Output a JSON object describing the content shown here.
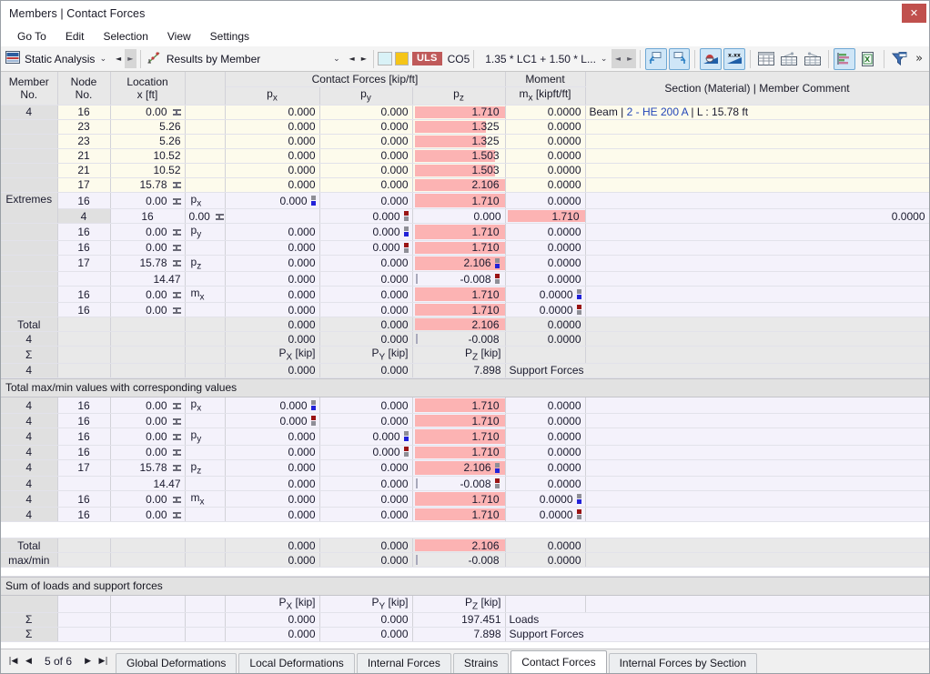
{
  "window": {
    "title": "Members | Contact Forces",
    "close_label": "✕"
  },
  "menu": {
    "items": [
      "Go To",
      "Edit",
      "Selection",
      "View",
      "Settings"
    ]
  },
  "toolbar": {
    "analysis_combo": {
      "label": "Static Analysis",
      "icon": "analysis-icon",
      "chevron": "⌄",
      "prev": "◄",
      "next": "►"
    },
    "results_combo": {
      "label": "Results by Member",
      "icon": "results-chart-icon",
      "chevron": "⌄",
      "prev": "◄",
      "next": "►"
    },
    "swatch_1_color": "#d9f2f7",
    "swatch_2_color": "#f5c518",
    "uls_badge": "ULS",
    "uls_color": "#bf5a5a",
    "combination_id": "CO5",
    "combination_text": "1.35 * LC1 + 1.50 * L...",
    "combination_chevron": "⌄",
    "combo_prev": "◄",
    "combo_next": "►",
    "icons": [
      {
        "name": "undo-arrow-icon",
        "active": true
      },
      {
        "name": "redo-arrow-icon",
        "active": true
      },
      {
        "name": "result-diagram-icon",
        "active": true
      },
      {
        "name": "result-values-icon",
        "active": true
      },
      {
        "name": "table-full-icon",
        "active": false
      },
      {
        "name": "table-filter-left-icon",
        "active": false
      },
      {
        "name": "table-filter-right-icon",
        "active": false
      },
      {
        "name": "bar-chart-icon",
        "active": true
      },
      {
        "name": "export-excel-icon",
        "active": false
      },
      {
        "name": "filter-funnel-icon",
        "active": false
      }
    ],
    "overflow_label": "»"
  },
  "table": {
    "headers": {
      "member_no": "Member\nNo.",
      "member_no_l1": "Member",
      "member_no_l2": "No.",
      "node_no_l1": "Node",
      "node_no_l2": "No.",
      "location_l1": "Location",
      "location_l2": "x [ft]",
      "contact_forces_group": "Contact Forces [kip/ft]",
      "px": "p",
      "px_sub": "x",
      "py": "p",
      "py_sub": "y",
      "pz": "p",
      "pz_sub": "z",
      "moment_group": "Moment",
      "mx": "m",
      "mx_sub": "x",
      "mx_unit": " [kipft/ft]",
      "section": "Section (Material) | Member Comment"
    },
    "member_rows": [
      {
        "member": "4",
        "node": "16",
        "loc": "0.00",
        "support": true,
        "sym": "",
        "px": "0.000",
        "py": "0.000",
        "pz": "1.710",
        "pzbar": 100,
        "mx": "0.0000",
        "sec_prefix": "Beam | ",
        "sec_link": "2 - HE 200 A",
        "sec_suffix": " | L : 15.78 ft",
        "style": "rowA"
      },
      {
        "member": "",
        "node": "23",
        "loc": "5.26",
        "support": false,
        "sym": "",
        "px": "0.000",
        "py": "0.000",
        "pz": "1.325",
        "pzbar": 78,
        "mx": "0.0000",
        "sec_prefix": "",
        "sec_link": "",
        "sec_suffix": "",
        "style": "rowA"
      },
      {
        "member": "",
        "node": "23",
        "loc": "5.26",
        "support": false,
        "sym": "",
        "px": "0.000",
        "py": "0.000",
        "pz": "1.325",
        "pzbar": 78,
        "mx": "0.0000",
        "sec_prefix": "",
        "sec_link": "",
        "sec_suffix": "",
        "style": "rowA"
      },
      {
        "member": "",
        "node": "21",
        "loc": "10.52",
        "support": false,
        "sym": "",
        "px": "0.000",
        "py": "0.000",
        "pz": "1.503",
        "pzbar": 88,
        "mx": "0.0000",
        "sec_prefix": "",
        "sec_link": "",
        "sec_suffix": "",
        "style": "rowA"
      },
      {
        "member": "",
        "node": "21",
        "loc": "10.52",
        "support": false,
        "sym": "",
        "px": "0.000",
        "py": "0.000",
        "pz": "1.503",
        "pzbar": 88,
        "mx": "0.0000",
        "sec_prefix": "",
        "sec_link": "",
        "sec_suffix": "",
        "style": "rowA"
      },
      {
        "member": "",
        "node": "17",
        "loc": "15.78",
        "support": true,
        "sym": "",
        "px": "0.000",
        "py": "0.000",
        "pz": "2.106",
        "pzbar": 100,
        "mx": "0.0000",
        "sec_prefix": "",
        "sec_link": "",
        "sec_suffix": "",
        "style": "rowA"
      }
    ],
    "extremes_label_l1": "Extremes",
    "extremes_label_l2": "4",
    "extreme_rows": [
      {
        "node": "16",
        "loc": "0.00",
        "support": true,
        "sym": "p",
        "sym_sub": "x",
        "px": "0.000",
        "px_mark": "max",
        "py": "0.000",
        "py_mark": "",
        "pz": "1.710",
        "pzbar": 100,
        "pz_mark": "",
        "mx": "0.0000",
        "mx_mark": ""
      },
      {
        "node": "16",
        "loc": "0.00",
        "support": true,
        "sym": "",
        "sym_sub": "",
        "px": "0.000",
        "px_mark": "min",
        "py": "0.000",
        "py_mark": "",
        "pz": "1.710",
        "pzbar": 100,
        "pz_mark": "",
        "mx": "0.0000",
        "mx_mark": ""
      },
      {
        "node": "16",
        "loc": "0.00",
        "support": true,
        "sym": "p",
        "sym_sub": "y",
        "px": "0.000",
        "px_mark": "",
        "py": "0.000",
        "py_mark": "max",
        "pz": "1.710",
        "pzbar": 100,
        "pz_mark": "",
        "mx": "0.0000",
        "mx_mark": ""
      },
      {
        "node": "16",
        "loc": "0.00",
        "support": true,
        "sym": "",
        "sym_sub": "",
        "px": "0.000",
        "px_mark": "",
        "py": "0.000",
        "py_mark": "min",
        "pz": "1.710",
        "pzbar": 100,
        "pz_mark": "",
        "mx": "0.0000",
        "mx_mark": ""
      },
      {
        "node": "17",
        "loc": "15.78",
        "support": true,
        "sym": "p",
        "sym_sub": "z",
        "px": "0.000",
        "px_mark": "",
        "py": "0.000",
        "py_mark": "",
        "pz": "2.106",
        "pzbar": 100,
        "pz_mark": "max",
        "mx": "0.0000",
        "mx_mark": ""
      },
      {
        "node": "",
        "loc": "14.47",
        "support": false,
        "sym": "",
        "sym_sub": "",
        "px": "0.000",
        "px_mark": "",
        "py": "0.000",
        "py_mark": "",
        "pz": "-0.008",
        "pzbar": 0,
        "pz_tick": true,
        "pz_mark": "min",
        "mx": "0.0000",
        "mx_mark": ""
      },
      {
        "node": "16",
        "loc": "0.00",
        "support": true,
        "sym": "m",
        "sym_sub": "x",
        "px": "0.000",
        "px_mark": "",
        "py": "0.000",
        "py_mark": "",
        "pz": "1.710",
        "pzbar": 100,
        "pz_mark": "",
        "mx": "0.0000",
        "mx_mark": "max"
      },
      {
        "node": "16",
        "loc": "0.00",
        "support": true,
        "sym": "",
        "sym_sub": "",
        "px": "0.000",
        "px_mark": "",
        "py": "0.000",
        "py_mark": "",
        "pz": "1.710",
        "pzbar": 100,
        "pz_mark": "",
        "mx": "0.0000",
        "mx_mark": "min"
      }
    ],
    "total_label_l1": "Total",
    "total_label_l2": "4",
    "total_rows": [
      {
        "px": "0.000",
        "py": "0.000",
        "pz": "2.106",
        "pzbar": 100,
        "pz_tick": false,
        "mx": "0.0000"
      },
      {
        "px": "0.000",
        "py": "0.000",
        "pz": "-0.008",
        "pzbar": 0,
        "pz_tick": true,
        "mx": "0.0000"
      }
    ],
    "sigma_label": "Σ",
    "sigma_member": "4",
    "sigma_headers": {
      "px": "P",
      "px_sub": "X",
      "px_unit": " [kip]",
      "py": "P",
      "py_sub": "Y",
      "py_unit": " [kip]",
      "pz": "P",
      "pz_sub": "Z",
      "pz_unit": " [kip]"
    },
    "sigma_row": {
      "px": "0.000",
      "py": "0.000",
      "pz": "7.898",
      "note": "Support Forces"
    }
  },
  "maxmin_section": {
    "band_title": "Total max/min values with corresponding values",
    "rows": [
      {
        "member": "4",
        "node": "16",
        "loc": "0.00",
        "support": true,
        "sym": "p",
        "sym_sub": "x",
        "px": "0.000",
        "px_mark": "max",
        "py": "0.000",
        "py_mark": "",
        "pz": "1.710",
        "pzbar": 100,
        "pz_mark": "",
        "mx": "0.0000",
        "mx_mark": ""
      },
      {
        "member": "4",
        "node": "16",
        "loc": "0.00",
        "support": true,
        "sym": "",
        "sym_sub": "",
        "px": "0.000",
        "px_mark": "min",
        "py": "0.000",
        "py_mark": "",
        "pz": "1.710",
        "pzbar": 100,
        "pz_mark": "",
        "mx": "0.0000",
        "mx_mark": ""
      },
      {
        "member": "4",
        "node": "16",
        "loc": "0.00",
        "support": true,
        "sym": "p",
        "sym_sub": "y",
        "px": "0.000",
        "px_mark": "",
        "py": "0.000",
        "py_mark": "max",
        "pz": "1.710",
        "pzbar": 100,
        "pz_mark": "",
        "mx": "0.0000",
        "mx_mark": ""
      },
      {
        "member": "4",
        "node": "16",
        "loc": "0.00",
        "support": true,
        "sym": "",
        "sym_sub": "",
        "px": "0.000",
        "px_mark": "",
        "py": "0.000",
        "py_mark": "min",
        "pz": "1.710",
        "pzbar": 100,
        "pz_mark": "",
        "mx": "0.0000",
        "mx_mark": ""
      },
      {
        "member": "4",
        "node": "17",
        "loc": "15.78",
        "support": true,
        "sym": "p",
        "sym_sub": "z",
        "px": "0.000",
        "px_mark": "",
        "py": "0.000",
        "py_mark": "",
        "pz": "2.106",
        "pzbar": 100,
        "pz_mark": "max",
        "mx": "0.0000",
        "mx_mark": ""
      },
      {
        "member": "4",
        "node": "",
        "loc": "14.47",
        "support": false,
        "sym": "",
        "sym_sub": "",
        "px": "0.000",
        "px_mark": "",
        "py": "0.000",
        "py_mark": "",
        "pz": "-0.008",
        "pzbar": 0,
        "pz_tick": true,
        "pz_mark": "min",
        "mx": "0.0000",
        "mx_mark": ""
      },
      {
        "member": "4",
        "node": "16",
        "loc": "0.00",
        "support": true,
        "sym": "m",
        "sym_sub": "x",
        "px": "0.000",
        "px_mark": "",
        "py": "0.000",
        "py_mark": "",
        "pz": "1.710",
        "pzbar": 100,
        "pz_mark": "",
        "mx": "0.0000",
        "mx_mark": "max"
      },
      {
        "member": "4",
        "node": "16",
        "loc": "0.00",
        "support": true,
        "sym": "",
        "sym_sub": "",
        "px": "0.000",
        "px_mark": "",
        "py": "0.000",
        "py_mark": "",
        "pz": "1.710",
        "pzbar": 100,
        "pz_mark": "",
        "mx": "0.0000",
        "mx_mark": "min"
      }
    ],
    "total_label_l1": "Total",
    "total_label_l2": "max/min",
    "total_rows": [
      {
        "px": "0.000",
        "py": "0.000",
        "pz": "2.106",
        "pzbar": 100,
        "pz_tick": false,
        "mx": "0.0000"
      },
      {
        "px": "0.000",
        "py": "0.000",
        "pz": "-0.008",
        "pzbar": 0,
        "pz_tick": true,
        "mx": "0.0000"
      }
    ]
  },
  "sum_section": {
    "band_title": "Sum of loads and support forces",
    "headers": {
      "px": "P",
      "px_sub": "X",
      "px_unit": " [kip]",
      "py": "P",
      "py_sub": "Y",
      "py_unit": " [kip]",
      "pz": "P",
      "pz_sub": "Z",
      "pz_unit": " [kip]"
    },
    "rows": [
      {
        "sigma": "Σ",
        "px": "0.000",
        "py": "0.000",
        "pz": "197.451",
        "note": "Loads"
      },
      {
        "sigma": "Σ",
        "px": "0.000",
        "py": "0.000",
        "pz": "7.898",
        "note": "Support Forces"
      }
    ]
  },
  "footer": {
    "first": "|◀",
    "prev": "◀",
    "next": "▶",
    "last": "▶|",
    "page_label": "5 of 6",
    "tabs": [
      {
        "label": "Global Deformations",
        "selected": false
      },
      {
        "label": "Local Deformations",
        "selected": false
      },
      {
        "label": "Internal Forces",
        "selected": false
      },
      {
        "label": "Strains",
        "selected": false
      },
      {
        "label": "Contact Forces",
        "selected": true
      },
      {
        "label": "Internal Forces by Section",
        "selected": false
      }
    ]
  }
}
